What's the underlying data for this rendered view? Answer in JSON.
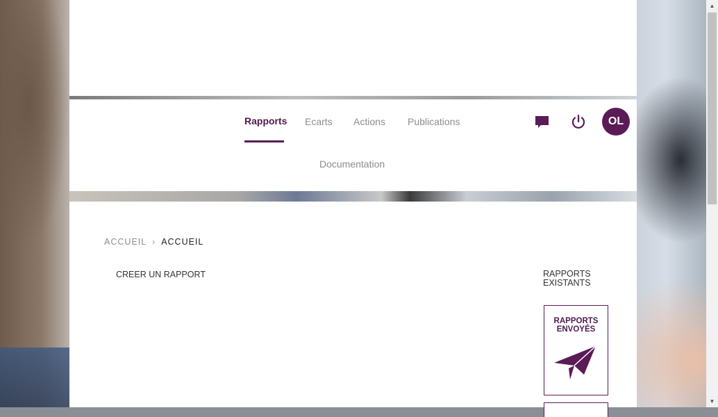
{
  "nav": {
    "items": [
      {
        "label": "Rapports",
        "active": true
      },
      {
        "label": "Ecarts",
        "active": false
      },
      {
        "label": "Actions",
        "active": false
      },
      {
        "label": "Publications",
        "active": false
      },
      {
        "label": "Documentation",
        "active": false
      }
    ],
    "icons": {
      "messages": "chat-bubble-icon",
      "logout": "power-icon"
    },
    "avatar_initials": "OL"
  },
  "breadcrumb": {
    "items": [
      "ACCUEIL",
      "ACCUEIL"
    ],
    "separator": "›"
  },
  "main": {
    "create_label": "CREER UN RAPPORT",
    "existing_title": "RAPPORTS EXISTANTS",
    "cards": [
      {
        "label": "RAPPORTS ENVOYÉS",
        "icon": "paper-plane-icon"
      }
    ]
  },
  "colors": {
    "brand": "#5a1b57",
    "nav_inactive": "#8c8c93"
  }
}
